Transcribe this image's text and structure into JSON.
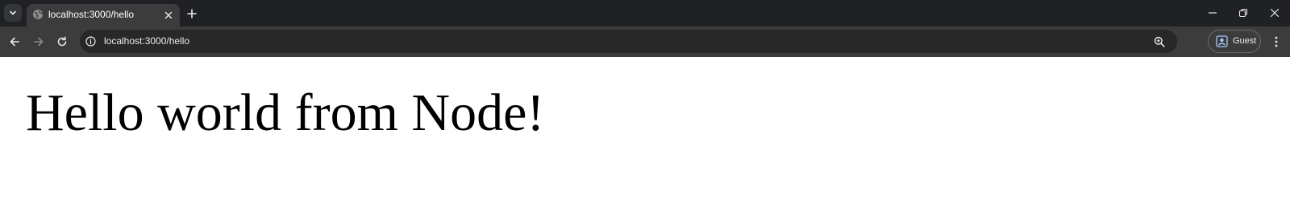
{
  "browser": {
    "tab": {
      "title": "localhost:3000/hello"
    },
    "toolbar": {
      "url": "localhost:3000/hello",
      "profile_label": "Guest"
    },
    "icons": {
      "tab_search": "chevron-down-icon",
      "favicon": "globe-icon",
      "tab_close": "close-icon",
      "new_tab": "plus-icon",
      "minimize": "minimize-icon",
      "restore": "restore-icon",
      "close_window": "close-icon",
      "back": "back-arrow-icon",
      "forward": "forward-arrow-icon",
      "reload": "reload-icon",
      "site_info": "info-icon",
      "zoom": "zoom-icon",
      "profile": "profile-icon",
      "menu": "kebab-menu-icon"
    },
    "colors": {
      "tabstrip_bg": "#202124",
      "toolbar_bg": "#3c3c3c",
      "omnibox_bg": "#282828",
      "text_light": "#e8eaed"
    }
  },
  "page": {
    "heading": "Hello world from Node!"
  }
}
